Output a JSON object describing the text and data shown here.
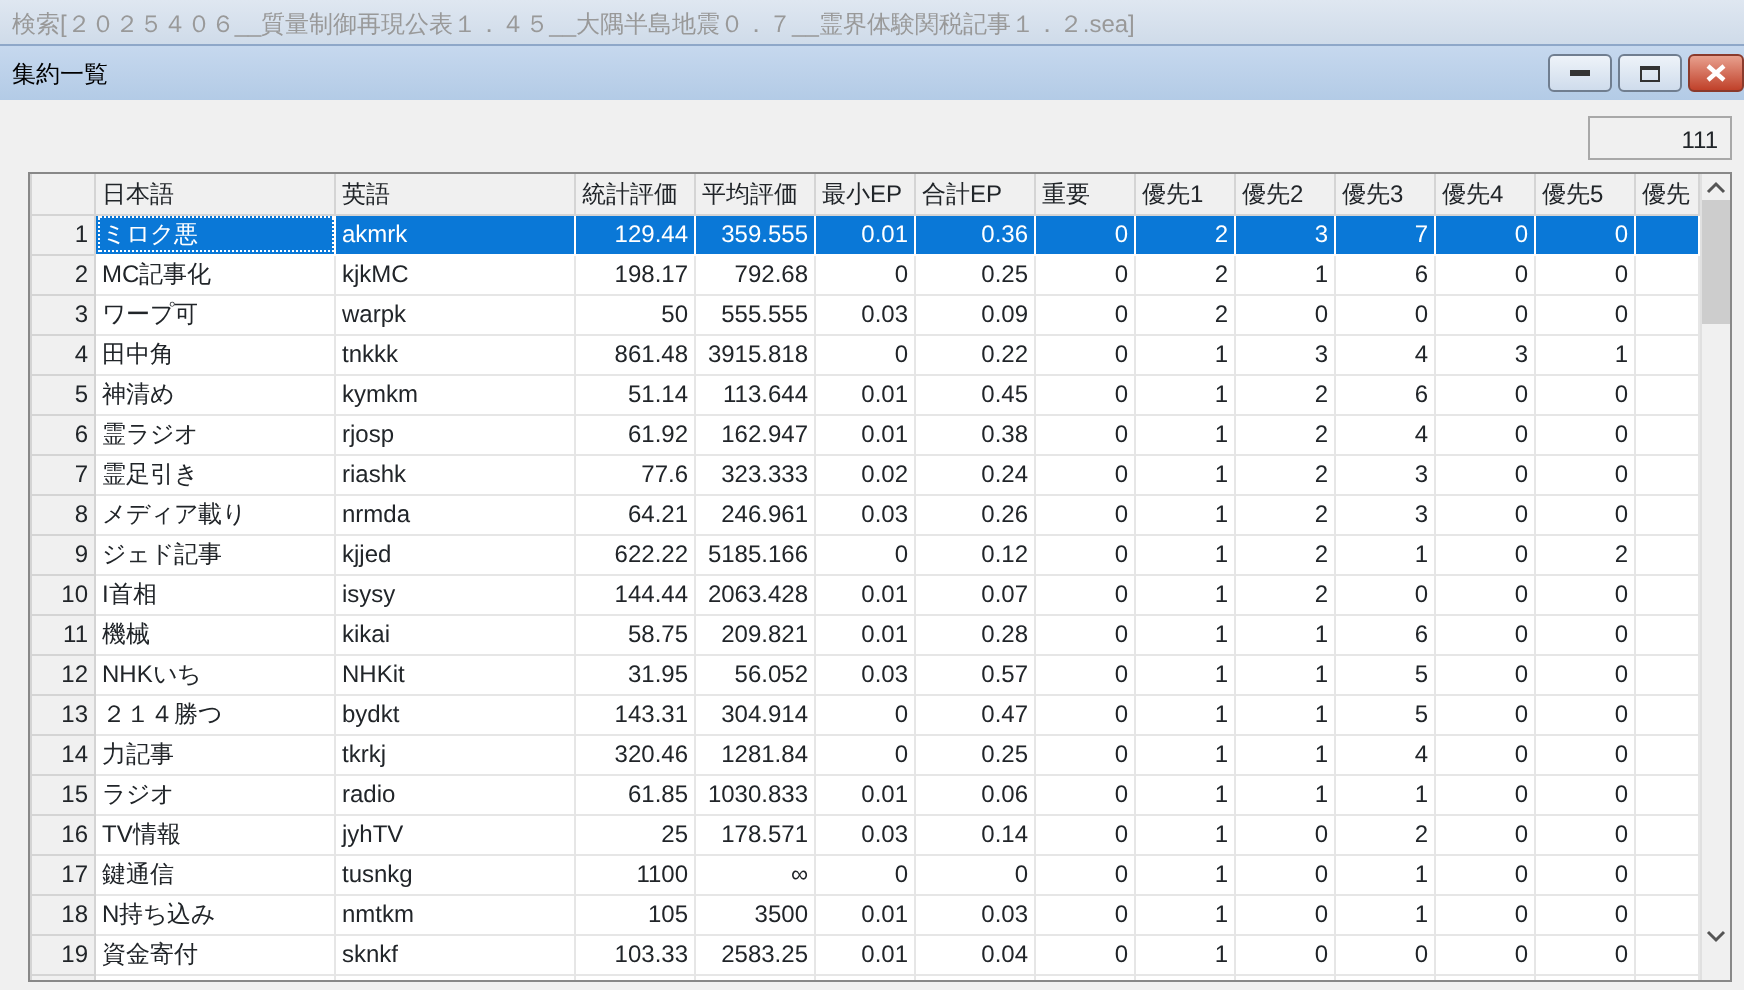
{
  "outer_window": {
    "title": "検索[２０２５４０６__質量制御再現公表１．４５__大隅半島地震０．７__霊界体験関税記事１．２.sea]"
  },
  "window": {
    "title": "集約一覧"
  },
  "count": "111",
  "table": {
    "columns": [
      "日本語",
      "英語",
      "統計評価",
      "平均評価",
      "最小EP",
      "合計EP",
      "重要",
      "優先1",
      "優先2",
      "優先3",
      "優先4",
      "優先5",
      "優先"
    ],
    "rows": [
      {
        "n": "1",
        "cells": [
          "ミロク悪",
          "akmrk",
          "129.44",
          "359.555",
          "0.01",
          "0.36",
          "0",
          "2",
          "3",
          "7",
          "0",
          "0",
          ""
        ],
        "selected": true
      },
      {
        "n": "2",
        "cells": [
          "MC記事化",
          "kjkMC",
          "198.17",
          "792.68",
          "0",
          "0.25",
          "0",
          "2",
          "1",
          "6",
          "0",
          "0",
          ""
        ],
        "selected": false
      },
      {
        "n": "3",
        "cells": [
          "ワープ可",
          "warpk",
          "50",
          "555.555",
          "0.03",
          "0.09",
          "0",
          "2",
          "0",
          "0",
          "0",
          "0",
          ""
        ],
        "selected": false
      },
      {
        "n": "4",
        "cells": [
          "田中角",
          "tnkkk",
          "861.48",
          "3915.818",
          "0",
          "0.22",
          "0",
          "1",
          "3",
          "4",
          "3",
          "1",
          ""
        ],
        "selected": false
      },
      {
        "n": "5",
        "cells": [
          "神清め",
          "kymkm",
          "51.14",
          "113.644",
          "0.01",
          "0.45",
          "0",
          "1",
          "2",
          "6",
          "0",
          "0",
          ""
        ],
        "selected": false
      },
      {
        "n": "6",
        "cells": [
          "霊ラジオ",
          "rjosp",
          "61.92",
          "162.947",
          "0.01",
          "0.38",
          "0",
          "1",
          "2",
          "4",
          "0",
          "0",
          ""
        ],
        "selected": false
      },
      {
        "n": "7",
        "cells": [
          "霊足引き",
          "riashk",
          "77.6",
          "323.333",
          "0.02",
          "0.24",
          "0",
          "1",
          "2",
          "3",
          "0",
          "0",
          ""
        ],
        "selected": false
      },
      {
        "n": "8",
        "cells": [
          "メディア載り",
          "nrmda",
          "64.21",
          "246.961",
          "0.03",
          "0.26",
          "0",
          "1",
          "2",
          "3",
          "0",
          "0",
          ""
        ],
        "selected": false
      },
      {
        "n": "9",
        "cells": [
          "ジェド記事",
          "kjjed",
          "622.22",
          "5185.166",
          "0",
          "0.12",
          "0",
          "1",
          "2",
          "1",
          "0",
          "2",
          ""
        ],
        "selected": false
      },
      {
        "n": "10",
        "cells": [
          "I首相",
          "isysy",
          "144.44",
          "2063.428",
          "0.01",
          "0.07",
          "0",
          "1",
          "2",
          "0",
          "0",
          "0",
          ""
        ],
        "selected": false
      },
      {
        "n": "11",
        "cells": [
          "機械",
          "kikai",
          "58.75",
          "209.821",
          "0.01",
          "0.28",
          "0",
          "1",
          "1",
          "6",
          "0",
          "0",
          ""
        ],
        "selected": false
      },
      {
        "n": "12",
        "cells": [
          "NHKいち",
          "NHKit",
          "31.95",
          "56.052",
          "0.03",
          "0.57",
          "0",
          "1",
          "1",
          "5",
          "0",
          "0",
          ""
        ],
        "selected": false
      },
      {
        "n": "13",
        "cells": [
          "２１４勝つ",
          "bydkt",
          "143.31",
          "304.914",
          "0",
          "0.47",
          "0",
          "1",
          "1",
          "5",
          "0",
          "0",
          ""
        ],
        "selected": false
      },
      {
        "n": "14",
        "cells": [
          "力記事",
          "tkrkj",
          "320.46",
          "1281.84",
          "0",
          "0.25",
          "0",
          "1",
          "1",
          "4",
          "0",
          "0",
          ""
        ],
        "selected": false
      },
      {
        "n": "15",
        "cells": [
          "ラジオ",
          "radio",
          "61.85",
          "1030.833",
          "0.01",
          "0.06",
          "0",
          "1",
          "1",
          "1",
          "0",
          "0",
          ""
        ],
        "selected": false
      },
      {
        "n": "16",
        "cells": [
          "TV情報",
          "jyhTV",
          "25",
          "178.571",
          "0.03",
          "0.14",
          "0",
          "1",
          "0",
          "2",
          "0",
          "0",
          ""
        ],
        "selected": false
      },
      {
        "n": "17",
        "cells": [
          "鍵通信",
          "tusnkg",
          "1100",
          "∞",
          "0",
          "0",
          "0",
          "1",
          "0",
          "1",
          "0",
          "0",
          ""
        ],
        "selected": false
      },
      {
        "n": "18",
        "cells": [
          "N持ち込み",
          "nmtkm",
          "105",
          "3500",
          "0.01",
          "0.03",
          "0",
          "1",
          "0",
          "1",
          "0",
          "0",
          ""
        ],
        "selected": false
      },
      {
        "n": "19",
        "cells": [
          "資金寄付",
          "sknkf",
          "103.33",
          "2583.25",
          "0.01",
          "0.04",
          "0",
          "1",
          "0",
          "0",
          "0",
          "0",
          ""
        ],
        "selected": false
      }
    ]
  }
}
